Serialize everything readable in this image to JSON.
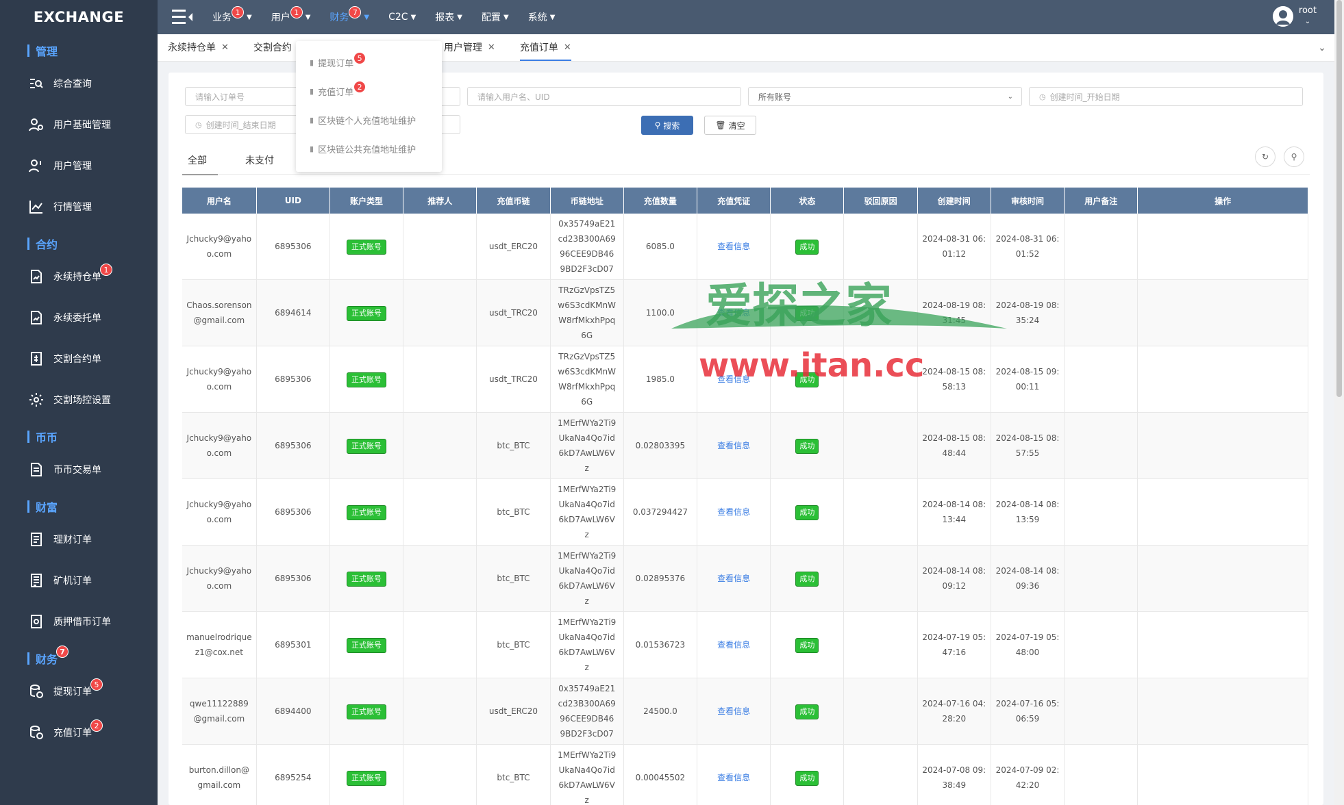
{
  "app": {
    "logo": "EXCHANGE"
  },
  "sidebar": {
    "sections": [
      {
        "title": "管理",
        "items": [
          {
            "label": "综合查询",
            "icon": "search-list-icon"
          },
          {
            "label": "用户基础管理",
            "icon": "user-gear-icon"
          },
          {
            "label": "用户管理",
            "icon": "user-icon"
          },
          {
            "label": "行情管理",
            "icon": "chart-icon"
          }
        ]
      },
      {
        "title": "合约",
        "items": [
          {
            "label": "永续持仓单",
            "badge": "1",
            "icon": "doc-chart-icon"
          },
          {
            "label": "永续委托单",
            "icon": "doc-chart-icon"
          },
          {
            "label": "交割合约单",
            "icon": "doc-dollar-icon"
          },
          {
            "label": "交割场控设置",
            "icon": "gear-icon"
          }
        ]
      },
      {
        "title": "币币",
        "items": [
          {
            "label": "币币交易单",
            "icon": "doc-icon"
          }
        ]
      },
      {
        "title": "财富",
        "items": [
          {
            "label": "理财订单",
            "icon": "finance-doc-icon"
          },
          {
            "label": "矿机订单",
            "icon": "list-doc-icon"
          },
          {
            "label": "质押借币订单",
            "icon": "pledge-doc-icon"
          }
        ]
      },
      {
        "title": "财务",
        "badge": "7",
        "items": [
          {
            "label": "提现订单",
            "badge": "5",
            "icon": "coins-icon"
          },
          {
            "label": "充值订单",
            "badge": "2",
            "icon": "coins-icon"
          }
        ]
      }
    ]
  },
  "topnav": {
    "items": [
      {
        "label": "业务",
        "badge": "1"
      },
      {
        "label": "用户",
        "badge": "1"
      },
      {
        "label": "财务",
        "badge": "7",
        "active": true
      },
      {
        "label": "C2C"
      },
      {
        "label": "报表"
      },
      {
        "label": "配置"
      },
      {
        "label": "系统"
      }
    ],
    "user": "root"
  },
  "tabs": [
    {
      "label": "永续持仓单"
    },
    {
      "label": "交割合约"
    },
    {
      "label": "用户管理"
    },
    {
      "label": "充值订单",
      "active": true
    }
  ],
  "dropdown": [
    {
      "label": "提现订单",
      "badge": "5"
    },
    {
      "label": "充值订单",
      "badge": "2"
    },
    {
      "label": "区块链个人充值地址维护"
    },
    {
      "label": "区块链公共充值地址维护"
    }
  ],
  "filters": {
    "order_no": "请输入订单号",
    "user": "请输入用户名、UID",
    "account": "所有账号",
    "start_date": "创建时间_开始日期",
    "end_date": "创建时间_结束日期",
    "search": "搜索",
    "clear": "清空"
  },
  "subtabs": [
    "全部",
    "未支付"
  ],
  "table": {
    "headers": [
      "用户名",
      "UID",
      "账户类型",
      "推荐人",
      "充值币链",
      "币链地址",
      "充值数量",
      "充值凭证",
      "状态",
      "驳回原因",
      "创建时间",
      "审核时间",
      "用户备注",
      "操作"
    ],
    "rows": [
      {
        "user": "Jchucky9@yahoo.com",
        "uid": "6895306",
        "type": "正式账号",
        "ref": "",
        "chain": "usdt_ERC20",
        "addr": "0x35749aE21cd23B300A6996CEE9DB469BD2F3cD07",
        "amount": "6085.0",
        "proof": "查看信息",
        "status": "成功",
        "reason": "",
        "created": "2024-08-31 06:01:12",
        "reviewed": "2024-08-31 06:01:52",
        "note": ""
      },
      {
        "user": "Chaos.sorenson@gmail.com",
        "uid": "6894614",
        "type": "正式账号",
        "ref": "",
        "chain": "usdt_TRC20",
        "addr": "TRzGzVpsTZ5w6S3cdKMnWW8rfMkxhPpq6G",
        "amount": "1100.0",
        "proof": "查看信息",
        "status": "成功",
        "reason": "",
        "created": "2024-08-19 08:31:45",
        "reviewed": "2024-08-19 08:35:24",
        "note": ""
      },
      {
        "user": "Jchucky9@yahoo.com",
        "uid": "6895306",
        "type": "正式账号",
        "ref": "",
        "chain": "usdt_TRC20",
        "addr": "TRzGzVpsTZ5w6S3cdKMnWW8rfMkxhPpq6G",
        "amount": "1985.0",
        "proof": "查看信息",
        "status": "成功",
        "reason": "",
        "created": "2024-08-15 08:58:13",
        "reviewed": "2024-08-15 09:00:11",
        "note": ""
      },
      {
        "user": "Jchucky9@yahoo.com",
        "uid": "6895306",
        "type": "正式账号",
        "ref": "",
        "chain": "btc_BTC",
        "addr": "1MErfWYa2Ti9UkaNa4Qo7id6kD7AwLW6Vz",
        "amount": "0.02803395",
        "proof": "查看信息",
        "status": "成功",
        "reason": "",
        "created": "2024-08-15 08:48:44",
        "reviewed": "2024-08-15 08:57:55",
        "note": ""
      },
      {
        "user": "Jchucky9@yahoo.com",
        "uid": "6895306",
        "type": "正式账号",
        "ref": "",
        "chain": "btc_BTC",
        "addr": "1MErfWYa2Ti9UkaNa4Qo7id6kD7AwLW6Vz",
        "amount": "0.037294427",
        "proof": "查看信息",
        "status": "成功",
        "reason": "",
        "created": "2024-08-14 08:13:44",
        "reviewed": "2024-08-14 08:13:59",
        "note": ""
      },
      {
        "user": "Jchucky9@yahoo.com",
        "uid": "6895306",
        "type": "正式账号",
        "ref": "",
        "chain": "btc_BTC",
        "addr": "1MErfWYa2Ti9UkaNa4Qo7id6kD7AwLW6Vz",
        "amount": "0.02895376",
        "proof": "查看信息",
        "status": "成功",
        "reason": "",
        "created": "2024-08-14 08:09:12",
        "reviewed": "2024-08-14 08:09:36",
        "note": ""
      },
      {
        "user": "manuelrodriquez1@cox.net",
        "uid": "6895301",
        "type": "正式账号",
        "ref": "",
        "chain": "btc_BTC",
        "addr": "1MErfWYa2Ti9UkaNa4Qo7id6kD7AwLW6Vz",
        "amount": "0.01536723",
        "proof": "查看信息",
        "status": "成功",
        "reason": "",
        "created": "2024-07-19 05:47:16",
        "reviewed": "2024-07-19 05:48:00",
        "note": ""
      },
      {
        "user": "qwe11122889@gmail.com",
        "uid": "6894400",
        "type": "正式账号",
        "ref": "",
        "chain": "usdt_ERC20",
        "addr": "0x35749aE21cd23B300A6996CEE9DB469BD2F3cD07",
        "amount": "24500.0",
        "proof": "查看信息",
        "status": "成功",
        "reason": "",
        "created": "2024-07-16 04:28:20",
        "reviewed": "2024-07-16 05:06:59",
        "note": ""
      },
      {
        "user": "burton.dillon@gmail.com",
        "uid": "6895254",
        "type": "正式账号",
        "ref": "",
        "chain": "btc_BTC",
        "addr": "1MErfWYa2Ti9UkaNa4Qo7id6kD7AwLW6Vz",
        "amount": "0.00045502",
        "proof": "查看信息",
        "status": "成功",
        "reason": "",
        "created": "2024-07-08 09:38:49",
        "reviewed": "2024-07-09 02:42:20",
        "note": ""
      }
    ]
  },
  "watermark": {
    "title": "爱探之家",
    "url": "www.itan.cc"
  },
  "colors": {
    "sidebar": "#2f3b4c",
    "topbar": "#495a70",
    "accent": "#3a7de3",
    "success": "#2bbf36",
    "badge": "#f04848"
  }
}
